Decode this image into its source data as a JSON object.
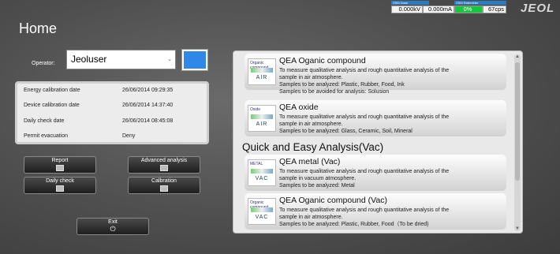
{
  "status": {
    "left_label": "SSM Dose",
    "right_label": "SSM Ratemeter",
    "kv": "0.000kV",
    "ma": "0.000mA",
    "percent": "0%",
    "cps": "67cps"
  },
  "logo": "JEOL",
  "title": "Home",
  "operator": {
    "label": "Operator:",
    "value": "Jeoluser",
    "color": "#2f88e8"
  },
  "info": [
    {
      "label": "Energy calibration date",
      "value": "26/06/2014 09:29:35"
    },
    {
      "label": "Device calibration date",
      "value": "26/06/2014 14:37:40"
    },
    {
      "label": "Daily check date",
      "value": "26/06/2014 08:45:08"
    },
    {
      "label": "Permit evacuation",
      "value": "Deny"
    }
  ],
  "buttons": {
    "report": "Report",
    "advanced": "Advanced analysis",
    "daily": "Daily check",
    "calibration": "Calbration",
    "exit": "Exit"
  },
  "cards": [
    {
      "thumb_top": "Organic compound",
      "thumb_bottom": "AIR",
      "title": "QEA Oganic compound",
      "line1": "To measure qualitative analysis and rough quantitative analysis of the",
      "line2": "sample in air atmosphere.",
      "line3": "Samples to be analyzed: Plastic, Rubber, Food, Ink",
      "line4": "Samples to be avoided for analysis: Solusion"
    },
    {
      "thumb_top": "Oxide",
      "thumb_bottom": "AIR",
      "title": "QEA oxide",
      "line1": "To measure qualitative analysis and rough quantitative analysis of the",
      "line2": "sample in air atmosphere.",
      "line3": "Samples to be analyzed: Glass, Ceramic, Soil, Mineral"
    },
    {
      "thumb_top": "METAL",
      "thumb_bottom": "VAC",
      "title": "QEA metal (Vac)",
      "line1": "To measure qualitative analysis and rough quantitative analysis of the",
      "line2": "sample in vacuum atmosphere.",
      "line3": "Samples to be analyzed: Metal"
    },
    {
      "thumb_top": "Organic compound",
      "thumb_bottom": "VAC",
      "title": "QEA Oganic compound (Vac)",
      "line1": "To measure qualitative analysis and rough quantitative analysis of the",
      "line2": "sample in air atmosphere.",
      "line3": "Samples to be analyzed: Plastic, Rubber, Food（To be dried)"
    }
  ],
  "section_title": "Quick and Easy Analysis(Vac)"
}
